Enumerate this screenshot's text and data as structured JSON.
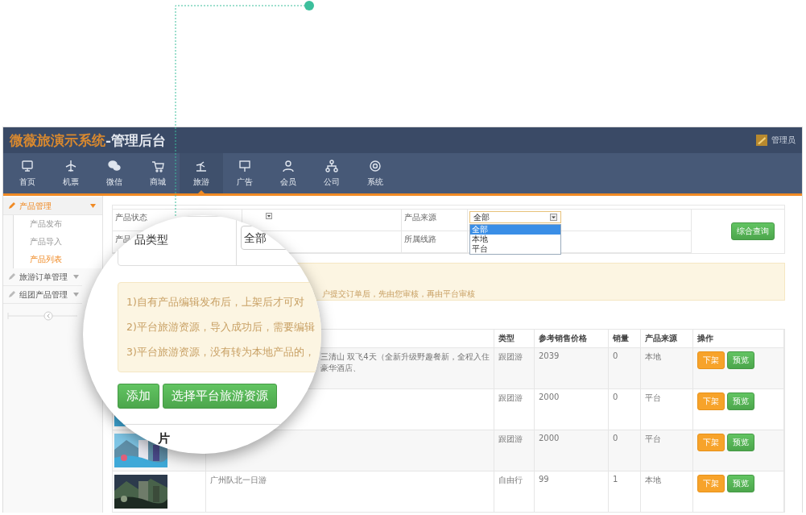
{
  "header": {
    "brand": "微薇旅演示系统",
    "title": "-管理后台",
    "user": "管理员"
  },
  "nav": [
    {
      "label": "首页",
      "selected": false
    },
    {
      "label": "机票",
      "selected": false
    },
    {
      "label": "微信",
      "selected": false
    },
    {
      "label": "商城",
      "selected": false
    },
    {
      "label": "旅游",
      "selected": true
    },
    {
      "label": "广告",
      "selected": false
    },
    {
      "label": "会员",
      "selected": false
    },
    {
      "label": "公司",
      "selected": false
    },
    {
      "label": "系统",
      "selected": false
    }
  ],
  "sidebar": [
    {
      "label": "产品管理",
      "expanded": true,
      "children": [
        {
          "label": "产品发布",
          "selected": false
        },
        {
          "label": "产品导入",
          "selected": false
        },
        {
          "label": "产品列表",
          "selected": true
        }
      ]
    },
    {
      "label": "旅游订单管理",
      "expanded": false
    },
    {
      "label": "组团产品管理",
      "expanded": false
    }
  ],
  "filters": {
    "status_label": "产品状态",
    "type_label": "产品",
    "source_label": "产品来源",
    "route_label": "所属线路",
    "source_value": "全部",
    "source_options": [
      {
        "label": "全部",
        "selected": true
      },
      {
        "label": "本地",
        "selected": false
      },
      {
        "label": "平台",
        "selected": false
      }
    ],
    "search_button": "综合查询"
  },
  "notice_tail": "户提交订单后，先由您审核，再由平台审核",
  "table": {
    "columns": [
      "类型",
      "参考销售价格",
      "销量",
      "产品来源",
      "操作"
    ],
    "rows": [
      {
        "name": "三清山 双飞4天（全新升级野趣餐新，全程入住豪华酒店、",
        "name_cut_left": true,
        "type": "跟团游",
        "price": "2039",
        "sales": "0",
        "source": "本地",
        "actions": [
          {
            "label": "下架",
            "kind": "unpublish"
          },
          {
            "label": "预览",
            "kind": "preview"
          }
        ]
      },
      {
        "picture": true,
        "type": "跟团游",
        "price": "2000",
        "sales": "0",
        "source": "平台",
        "actions": [
          {
            "label": "下架",
            "kind": "unpublish"
          },
          {
            "label": "预览",
            "kind": "preview"
          }
        ]
      },
      {
        "picture": true,
        "type": "跟团游",
        "price": "2000",
        "sales": "0",
        "source": "平台",
        "actions": [
          {
            "label": "下架",
            "kind": "unpublish"
          },
          {
            "label": "预览",
            "kind": "preview"
          }
        ]
      },
      {
        "picture": true,
        "name": "广州队北一日游",
        "name_cut_left": false,
        "type": "自由行",
        "price": "99",
        "sales": "1",
        "source": "本地",
        "actions": [
          {
            "label": "下架",
            "kind": "unpublish"
          },
          {
            "label": "预览",
            "kind": "preview"
          }
        ]
      }
    ]
  },
  "magnifier": {
    "filter_label": "品类型",
    "filter_value": "全部",
    "notes": [
      "1)自有产品编辑发布后，上架后才可对",
      "2)平台旅游资源，导入成功后，需要编辑",
      "3)平台旅游资源，没有转为本地产品的，"
    ],
    "buttons": [
      "添加",
      "选择平台旅游资源"
    ],
    "column_fragment": "片"
  }
}
